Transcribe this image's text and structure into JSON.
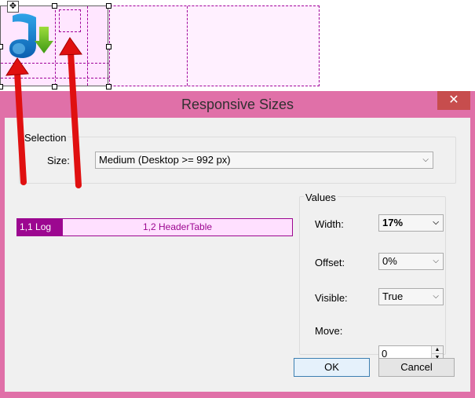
{
  "dialog": {
    "title": "Responsive Sizes",
    "close_glyph": "✕",
    "selection": {
      "legend": "Selection",
      "size_label": "Size:",
      "size_value": "Medium (Desktop >= 992 px)"
    },
    "grid_cells": [
      {
        "label": "1,1 Log"
      },
      {
        "label": "1,2 HeaderTable"
      }
    ],
    "values": {
      "legend": "Values",
      "width_label": "Width:",
      "width_value": "17%",
      "offset_label": "Offset:",
      "offset_value": "0%",
      "visible_label": "Visible:",
      "visible_value": "True",
      "move_label": "Move:",
      "move_value": "0"
    },
    "ok_label": "OK",
    "cancel_label": "Cancel"
  },
  "designer": {
    "move_handle_glyph": "✥",
    "icon": "music-download-icon"
  },
  "colors": {
    "title_bar": "#e070a8",
    "cell_selected": "#9c0790",
    "cell_normal": "#ffe0ff",
    "arrow": "#e01010"
  }
}
